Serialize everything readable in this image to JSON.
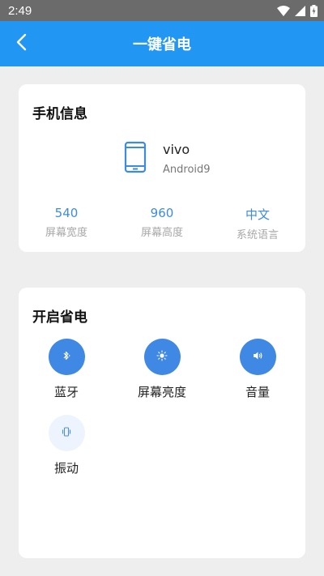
{
  "status_bar": {
    "time": "2:49"
  },
  "app_bar": {
    "title": "一键省电"
  },
  "phone_info": {
    "title": "手机信息",
    "brand": "vivo",
    "os": "Android9",
    "stats": [
      {
        "value": "540",
        "label": "屏幕宽度"
      },
      {
        "value": "960",
        "label": "屏幕高度"
      },
      {
        "value": "中文",
        "label": "系统语言"
      }
    ]
  },
  "power_saving": {
    "title": "开启省电",
    "toggles": [
      {
        "label": "蓝牙",
        "icon": "bluetooth-icon",
        "active": true
      },
      {
        "label": "屏幕亮度",
        "icon": "brightness-icon",
        "active": true
      },
      {
        "label": "音量",
        "icon": "volume-icon",
        "active": true
      },
      {
        "label": "振动",
        "icon": "vibration-icon",
        "active": false
      }
    ]
  },
  "colors": {
    "primary": "#2196f3",
    "accent": "#3f88e4",
    "inactive": "#eef4fd",
    "stat_value": "#3d8be0"
  }
}
